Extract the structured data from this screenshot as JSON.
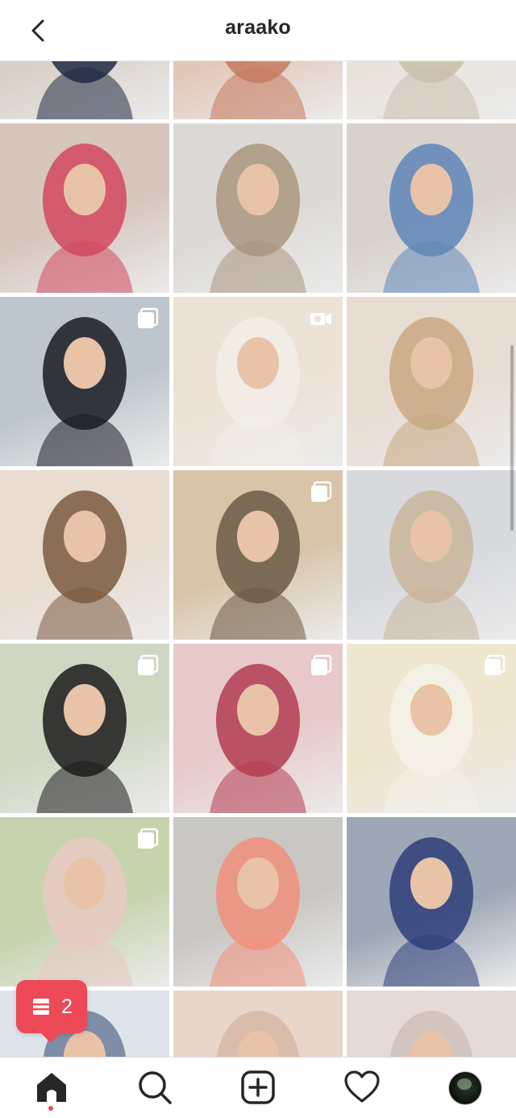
{
  "header": {
    "title": "araako",
    "back_icon": "chevron-left-icon"
  },
  "grid": {
    "posts": [
      {
        "label": "post-1",
        "bg": "#d9cfc6",
        "accent": "#1f2a44",
        "multi": false,
        "video": false
      },
      {
        "label": "post-2",
        "bg": "#e2c7b8",
        "accent": "#c47a5e",
        "multi": false,
        "video": false
      },
      {
        "label": "post-3",
        "bg": "#e9e3da",
        "accent": "#c9c0ae",
        "multi": false,
        "video": false
      },
      {
        "label": "post-4",
        "bg": "#d6c6bd",
        "accent": "#d2485f",
        "multi": false,
        "video": false
      },
      {
        "label": "post-5",
        "bg": "#dcdad6",
        "accent": "#a99680",
        "multi": false,
        "video": false
      },
      {
        "label": "post-6",
        "bg": "#d9d2cc",
        "accent": "#5e86b8",
        "multi": false,
        "video": false
      },
      {
        "label": "post-7",
        "bg": "#bcc6cc",
        "accent": "#1a1a22",
        "multi": true,
        "video": false
      },
      {
        "label": "post-8",
        "bg": "#ece3d6",
        "accent": "#f2eee8",
        "multi": false,
        "video": true
      },
      {
        "label": "post-9",
        "bg": "#e8ddd2",
        "accent": "#c9a884",
        "multi": false,
        "video": false
      },
      {
        "label": "post-10",
        "bg": "#e9dcd0",
        "accent": "#7a5a40",
        "multi": false,
        "video": false
      },
      {
        "label": "post-11",
        "bg": "#d8c5a8",
        "accent": "#6b5a45",
        "multi": true,
        "video": false
      },
      {
        "label": "post-12",
        "bg": "#d7d9dd",
        "accent": "#c9b59b",
        "multi": false,
        "video": false
      },
      {
        "label": "post-13",
        "bg": "#cfd7c2",
        "accent": "#1b1b1b",
        "multi": true,
        "video": false
      },
      {
        "label": "post-14",
        "bg": "#e8c9c9",
        "accent": "#b23c52",
        "multi": true,
        "video": false
      },
      {
        "label": "post-15",
        "bg": "#efe6cf",
        "accent": "#f4f1ea",
        "multi": true,
        "video": false
      },
      {
        "label": "post-16",
        "bg": "#c6d3ad",
        "accent": "#e7c9c3",
        "multi": true,
        "video": false
      },
      {
        "label": "post-17",
        "bg": "#c9c7c4",
        "accent": "#f08f7a",
        "multi": false,
        "video": false
      },
      {
        "label": "post-18",
        "bg": "#9da7b6",
        "accent": "#2e3e7a",
        "multi": false,
        "video": false
      },
      {
        "label": "post-19",
        "bg": "#dfe3ea",
        "accent": "#6d7f9a",
        "multi": false,
        "video": false
      },
      {
        "label": "post-20",
        "bg": "#e9d6cb",
        "accent": "#d6b7a4",
        "multi": false,
        "video": false
      },
      {
        "label": "post-21",
        "bg": "#e6dad6",
        "accent": "#cfbfb8",
        "multi": false,
        "video": false
      }
    ]
  },
  "notification": {
    "count": "2",
    "icon": "posts-icon",
    "color": "#ed4956"
  },
  "tabbar": {
    "home_icon": "home-icon",
    "search_icon": "search-icon",
    "new_post_icon": "add-post-icon",
    "activity_icon": "heart-icon",
    "profile_icon": "profile-avatar"
  }
}
